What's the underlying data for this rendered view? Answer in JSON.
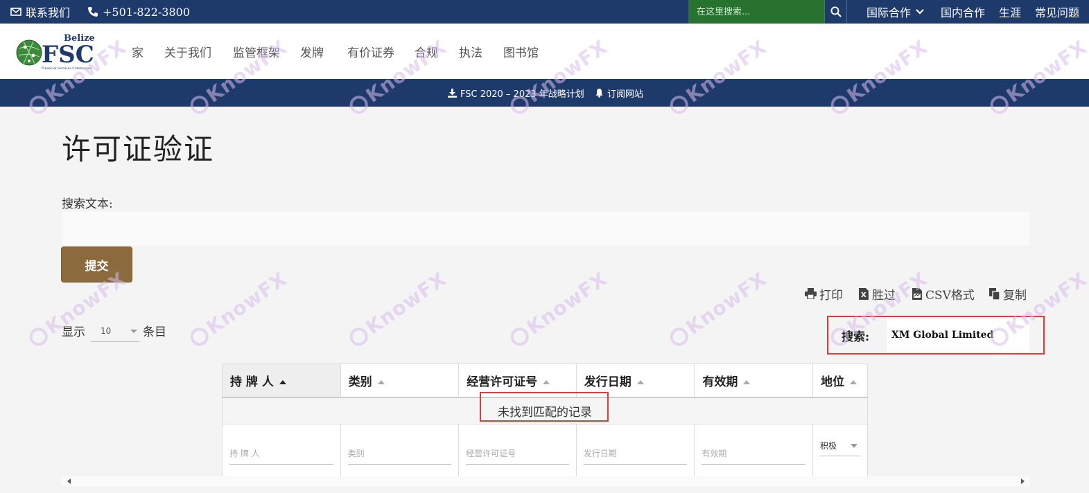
{
  "topbar": {
    "contact_label": "联系我们",
    "phone": "+501-822-3800",
    "search_placeholder": "在这里搜索...",
    "nav": [
      "国际合作",
      "国内合作",
      "生涯",
      "常见问题"
    ]
  },
  "logo": {
    "top_text": "Belize",
    "main_text": "FSC",
    "sub_text": "Financial Services Commission"
  },
  "main_nav": [
    "家",
    "关于我们",
    "监管框架",
    "发牌",
    "有价证券",
    "合规",
    "执法",
    "图书馆"
  ],
  "banner": {
    "strategy_link": "FSC 2020 – 2023 年战略计划",
    "subscribe_link": "订阅网站"
  },
  "page": {
    "title": "许可证验证",
    "search_text_label": "搜索文本:",
    "submit_label": "提交"
  },
  "tools": {
    "print": "打印",
    "excel": "胜过",
    "csv": "CSV格式",
    "copy": "复制"
  },
  "length": {
    "show": "显示",
    "value": "10",
    "entries": "条目"
  },
  "filter": {
    "label": "搜索:",
    "value": "XM Global Limited"
  },
  "table": {
    "headers": [
      "持 牌 人",
      "类别",
      "经营许可证号",
      "发行日期",
      "有效期",
      "地位"
    ],
    "empty_message": "未找到匹配的记录",
    "filter_placeholders": [
      "持 牌 人",
      "类别",
      "经营许可证号",
      "发行日期",
      "有效期"
    ],
    "status_filter_value": "积极"
  },
  "watermark": {
    "text": "KnowFX"
  },
  "colors": {
    "navy": "#1e3a6b",
    "green_search": "#27722e",
    "submit_brown": "#8b6a3e",
    "highlight_red": "#e03a3a"
  }
}
